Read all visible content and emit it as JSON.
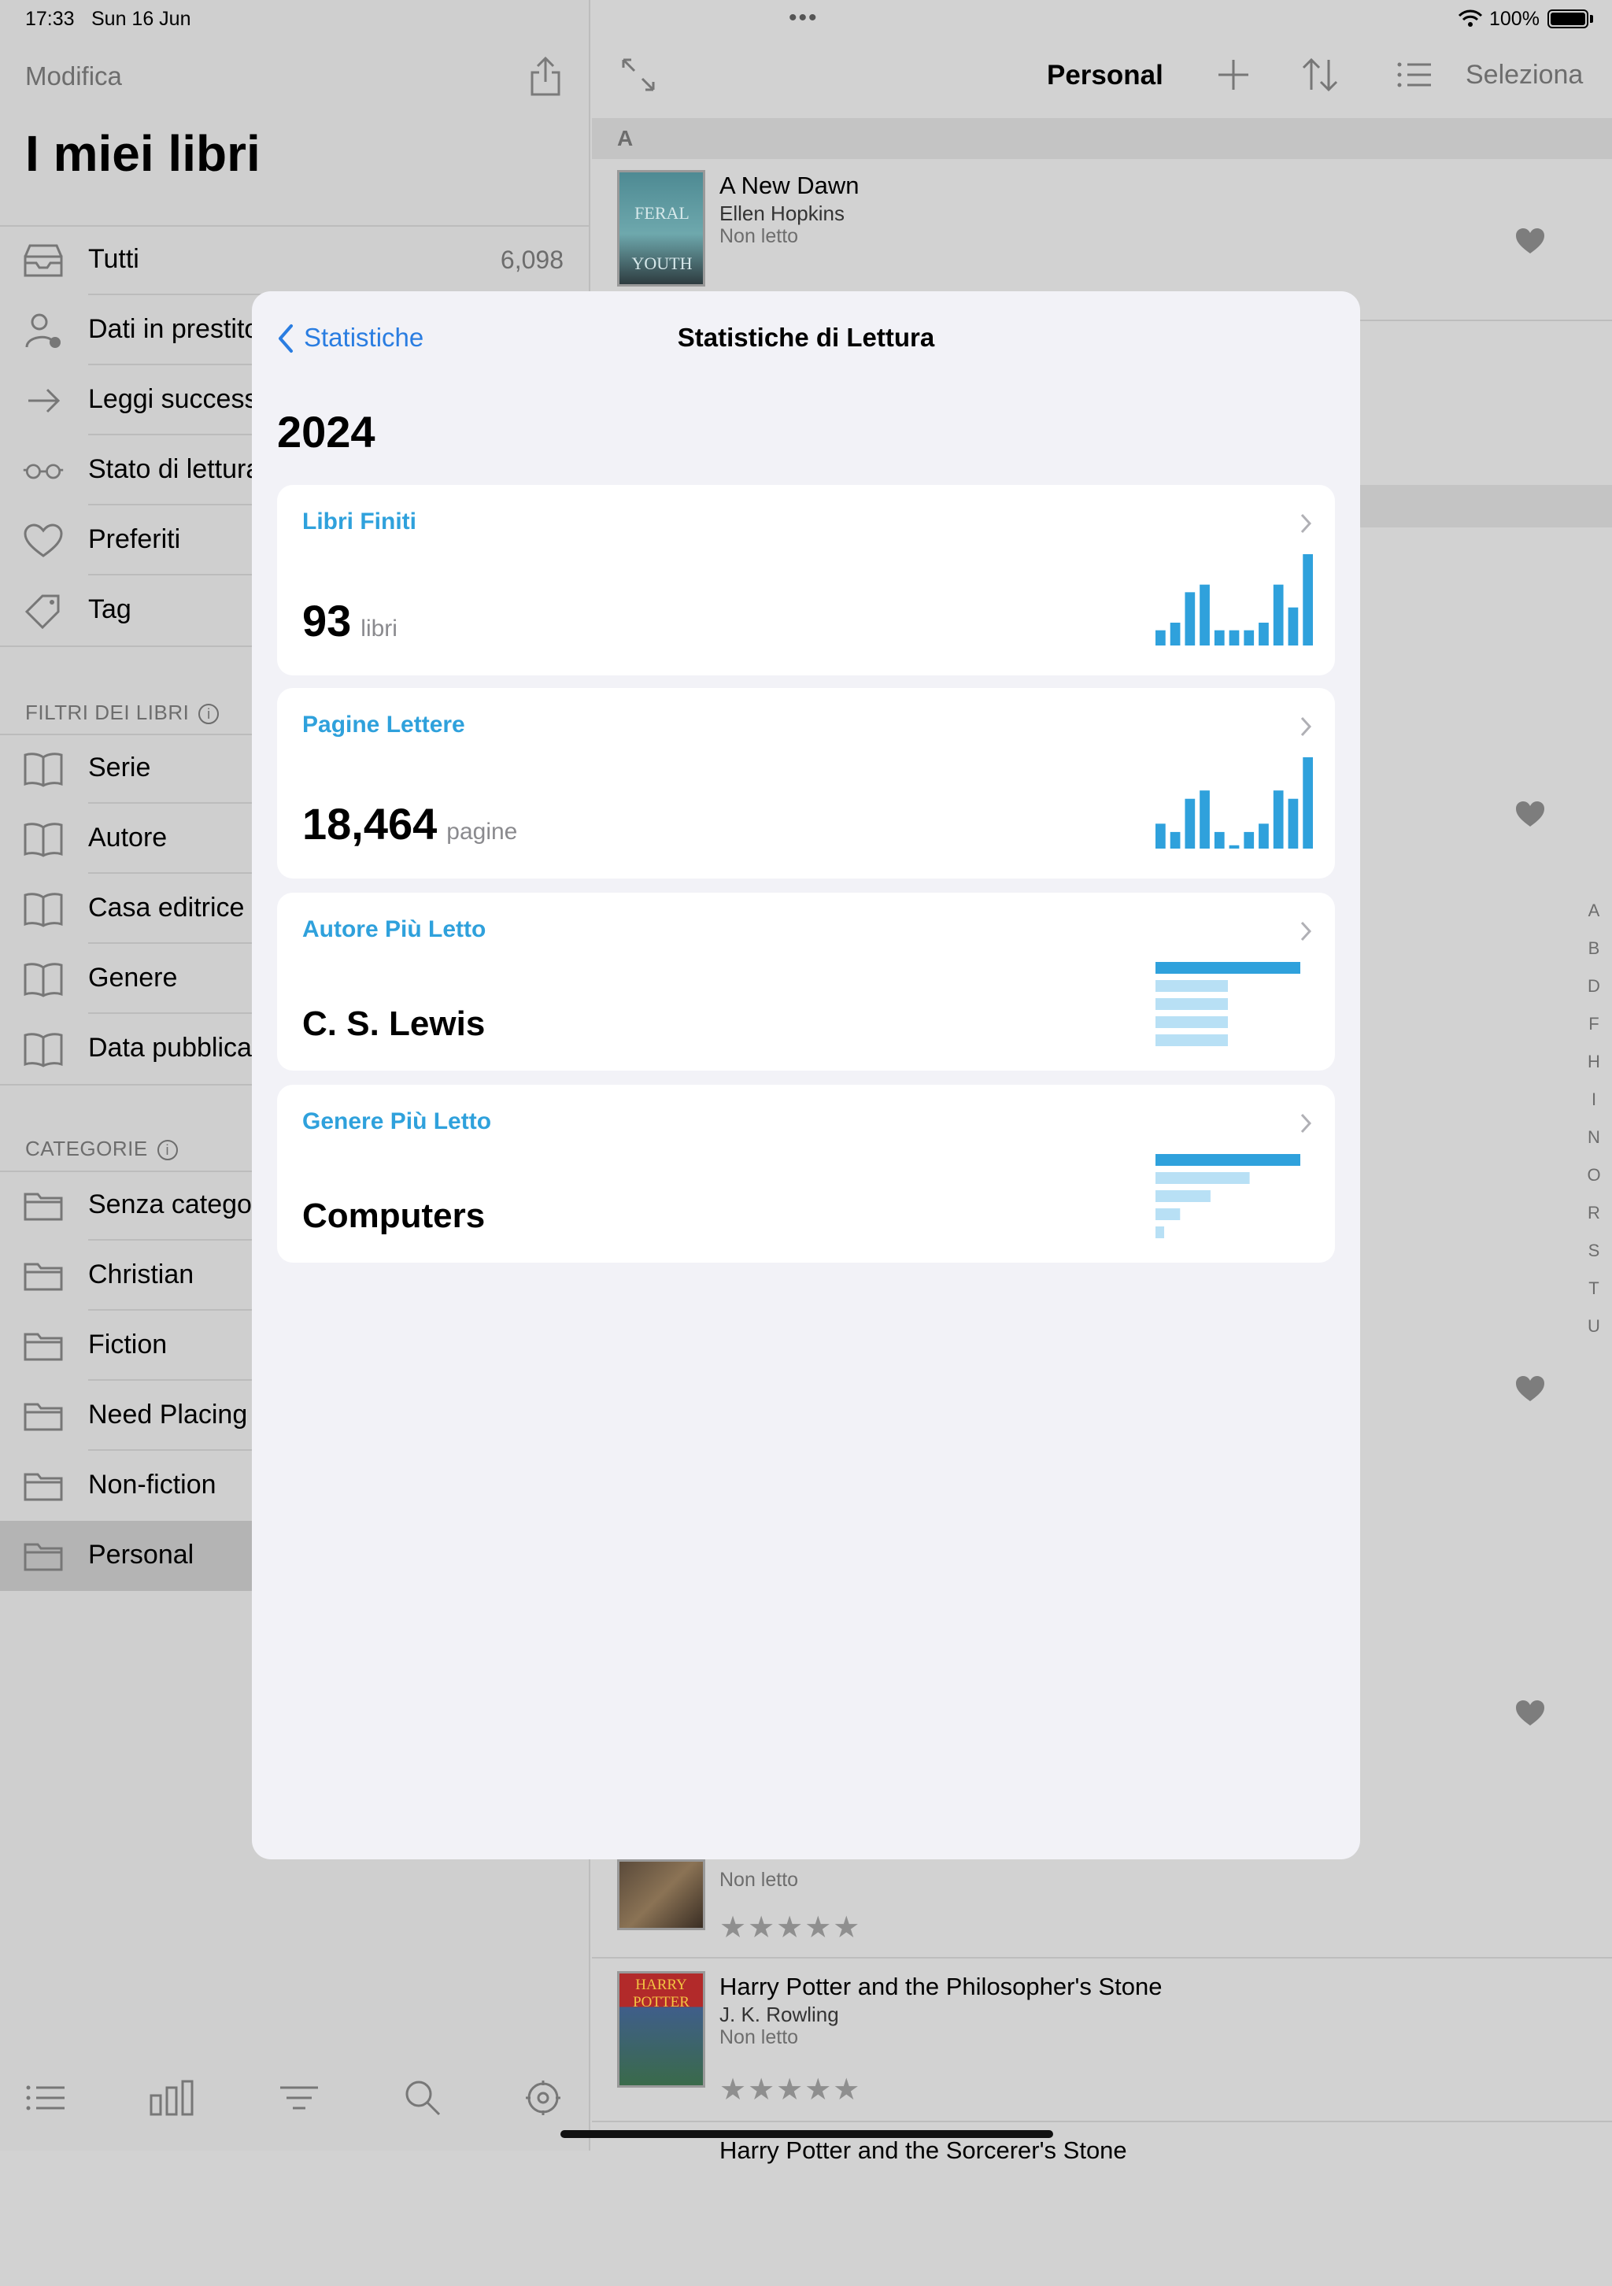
{
  "status": {
    "time": "17:33",
    "date": "Sun 16 Jun",
    "battery": "100%"
  },
  "sidebar": {
    "edit_label": "Modifica",
    "title": "I miei libri",
    "library": [
      {
        "label": "Tutti",
        "count": "6,098",
        "icon": "tray-icon"
      },
      {
        "label": "Dati in prestito",
        "icon": "person-clock-icon"
      },
      {
        "label": "Leggi successivamente",
        "icon": "arrow-right-icon"
      },
      {
        "label": "Stato di lettura",
        "icon": "glasses-icon"
      },
      {
        "label": "Preferiti",
        "icon": "heart-icon"
      },
      {
        "label": "Tag",
        "icon": "tag-icon"
      }
    ],
    "filters_header": "FILTRI DEI LIBRI",
    "filters": [
      {
        "label": "Serie"
      },
      {
        "label": "Autore"
      },
      {
        "label": "Casa editrice"
      },
      {
        "label": "Genere"
      },
      {
        "label": "Data pubblicazione"
      }
    ],
    "categories_header": "CATEGORIE",
    "categories": [
      {
        "label": "Senza categoria"
      },
      {
        "label": "Christian"
      },
      {
        "label": "Fiction"
      },
      {
        "label": "Need Placing"
      },
      {
        "label": "Non-fiction"
      },
      {
        "label": "Personal",
        "selected": true
      }
    ],
    "tabbar": [
      "list-icon",
      "chart-icon",
      "filter-icon",
      "search-icon",
      "settings-icon"
    ]
  },
  "main": {
    "title": "Personal",
    "select_label": "Seleziona",
    "section_letter": "A",
    "books": [
      {
        "title": "A New Dawn",
        "author": "Ellen Hopkins",
        "status": "Non letto",
        "cover_text": "FERAL YOUTH"
      },
      {
        "title": "",
        "author": "",
        "status": "Non letto",
        "cover_text": ""
      },
      {
        "title": "Harry Potter and the Philosopher's Stone",
        "author": "J. K. Rowling",
        "status": "Non letto",
        "cover_text": "HARRY POTTER"
      },
      {
        "title": "Harry Potter and the Sorcerer's Stone",
        "author": "",
        "status": "",
        "cover_text": ""
      }
    ],
    "rating_stars": "★★★★★",
    "index_letters": [
      "A",
      "B",
      "D",
      "F",
      "H",
      "I",
      "N",
      "O",
      "R",
      "S",
      "T",
      "U"
    ]
  },
  "modal": {
    "back_label": "Statistiche",
    "title": "Statistiche di Lettura",
    "year": "2024",
    "cards": [
      {
        "title": "Libri Finiti",
        "value": "93",
        "unit": "libri"
      },
      {
        "title": "Pagine Lettere",
        "value": "18,464",
        "unit": "pagine"
      },
      {
        "title": "Autore Più Letto",
        "value": "C. S. Lewis"
      },
      {
        "title": "Genere Più Letto",
        "value": "Computers"
      }
    ],
    "accent": "#2fa1dc"
  },
  "chart_data": [
    {
      "type": "bar",
      "values": [
        2,
        3,
        7,
        8,
        2,
        2,
        2,
        3,
        8,
        5,
        12
      ]
    },
    {
      "type": "bar",
      "values": [
        3,
        2,
        6,
        7,
        2,
        0.4,
        2,
        3,
        7,
        6,
        11
      ]
    },
    {
      "type": "bar",
      "orientation": "horizontal",
      "values": [
        10,
        5,
        5,
        5,
        5
      ]
    },
    {
      "type": "bar",
      "orientation": "horizontal",
      "values": [
        10,
        6.5,
        3.8,
        1.7,
        0.6
      ]
    }
  ]
}
